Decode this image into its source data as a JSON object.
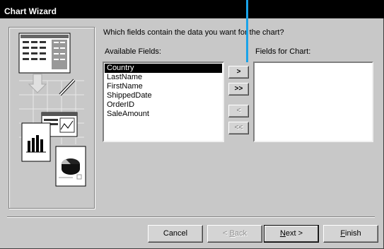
{
  "window": {
    "title": "Chart Wizard"
  },
  "prompt": "Which fields contain the data you want for the chart?",
  "available": {
    "label": "Available Fields:",
    "items": [
      "Country",
      "LastName",
      "FirstName",
      "ShippedDate",
      "OrderID",
      "SaleAmount"
    ],
    "selected_index": 0
  },
  "chart_fields": {
    "label": "Fields for Chart:",
    "items": []
  },
  "move_buttons": {
    "add_one": ">",
    "add_all": ">>",
    "remove_one": "<",
    "remove_all": "<<"
  },
  "footer": {
    "cancel": "Cancel",
    "back_mn": "B",
    "back_rest": "ack",
    "back_prefix": "< ",
    "next_mn": "N",
    "next_rest": "ext >",
    "finish_mn": "F",
    "finish_rest": "inish"
  },
  "colors": {
    "titlebar": "#000000",
    "dialog": "#c8c8c8",
    "annotation_line": "#1aa3e8"
  }
}
